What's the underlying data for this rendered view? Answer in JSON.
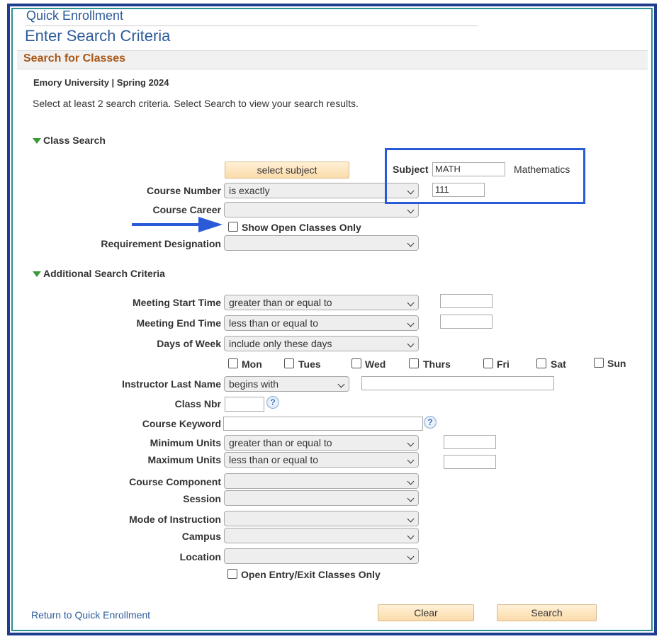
{
  "header": {
    "title": "Quick Enrollment",
    "subtitle": "Enter Search Criteria"
  },
  "section": {
    "title": "Search for Classes"
  },
  "institution_term": "Emory University | Spring 2024",
  "instructions": "Select at least 2 search criteria. Select Search to view your search results.",
  "class_search": {
    "group_label": "Class Search",
    "select_subject_button": "select subject",
    "subject_label": "Subject",
    "subject_value": "MATH",
    "subject_description": "Mathematics",
    "course_number_label": "Course Number",
    "course_number_operator": "is exactly",
    "course_number_value": "111",
    "course_career_label": "Course Career",
    "course_career_value": "",
    "show_open_only_label": "Show Open Classes Only",
    "show_open_only_checked": false,
    "requirement_label": "Requirement Designation",
    "requirement_value": ""
  },
  "additional": {
    "group_label": "Additional Search Criteria",
    "meeting_start_label": "Meeting Start Time",
    "meeting_start_operator": "greater than or equal to",
    "meeting_start_value": "",
    "meeting_end_label": "Meeting End Time",
    "meeting_end_operator": "less than or equal to",
    "meeting_end_value": "",
    "days_label": "Days of Week",
    "days_operator": "include only these days",
    "days": [
      {
        "label": "Mon",
        "checked": false
      },
      {
        "label": "Tues",
        "checked": false
      },
      {
        "label": "Wed",
        "checked": false
      },
      {
        "label": "Thurs",
        "checked": false
      },
      {
        "label": "Fri",
        "checked": false
      },
      {
        "label": "Sat",
        "checked": false
      },
      {
        "label": "Sun",
        "checked": false
      }
    ],
    "instructor_label": "Instructor Last Name",
    "instructor_operator": "begins with",
    "instructor_value": "",
    "class_nbr_label": "Class Nbr",
    "class_nbr_value": "",
    "keyword_label": "Course Keyword",
    "keyword_value": "",
    "min_units_label": "Minimum Units",
    "min_units_operator": "greater than or equal to",
    "min_units_value": "",
    "max_units_label": "Maximum Units",
    "max_units_operator": "less than or equal to",
    "max_units_value": "",
    "component_label": "Course Component",
    "session_label": "Session",
    "mode_label": "Mode of Instruction",
    "campus_label": "Campus",
    "location_label": "Location",
    "open_entry_label": "Open Entry/Exit Classes Only"
  },
  "footer": {
    "return_link": "Return to Quick Enrollment",
    "clear_button": "Clear",
    "search_button": "Search"
  },
  "help_glyph": "?",
  "colors": {
    "frame": "#1f3d8f",
    "highlight": "#2a5ad8",
    "section_title": "#a85614",
    "link": "#2d5b9a"
  }
}
